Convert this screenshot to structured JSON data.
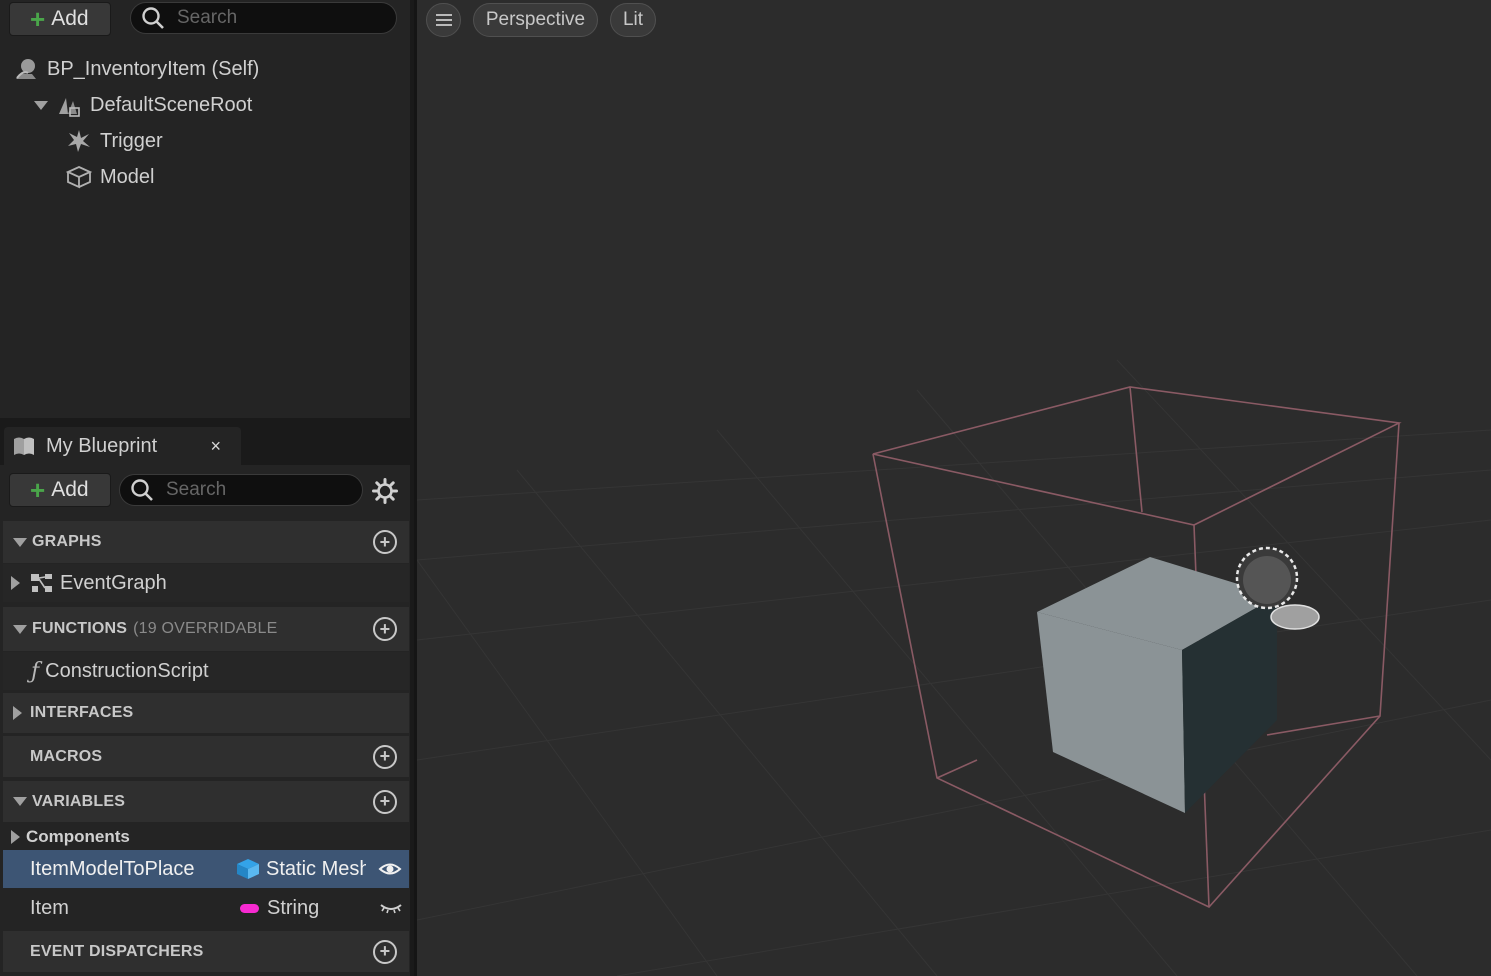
{
  "components": {
    "add_label": "Add",
    "search_placeholder": "Search",
    "tree": [
      {
        "label": "BP_InventoryItem (Self)"
      },
      {
        "label": "DefaultSceneRoot"
      },
      {
        "label": "Trigger"
      },
      {
        "label": "Model"
      }
    ]
  },
  "my_blueprint": {
    "tab_label": "My Blueprint",
    "close_glyph": "×",
    "add_label": "Add",
    "search_placeholder": "Search",
    "sections": {
      "graphs": "GRAPHS",
      "functions": "FUNCTIONS",
      "functions_sub": "(19 OVERRIDABLE",
      "interfaces": "INTERFACES",
      "macros": "MACROS",
      "variables": "VARIABLES",
      "event_dispatchers": "EVENT DISPATCHERS"
    },
    "graphs": [
      {
        "label": "EventGraph"
      }
    ],
    "functions": [
      {
        "label": "ConstructionScript"
      }
    ],
    "variables_category": "Components",
    "variables": [
      {
        "name": "ItemModelToPlace",
        "type": "Static Mesh",
        "type_color": "#33a3e8",
        "visibility": "eye-open",
        "selected": true
      },
      {
        "name": "Item",
        "type": "String",
        "type_color": "#f72ad1",
        "visibility": "eye-closed",
        "selected": false
      }
    ]
  },
  "viewport": {
    "view_mode": "Perspective",
    "lighting": "Lit"
  },
  "colors": {
    "accent_green": "#4aa54a",
    "selection": "#3d5574",
    "viewport_bg": "#2c2c2c"
  }
}
